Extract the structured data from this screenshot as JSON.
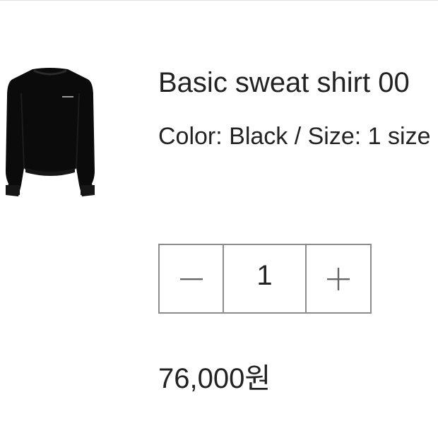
{
  "product": {
    "title": "Basic sweat shirt 00",
    "options": "Color: Black / Size: 1 size",
    "image_icon": "black-sweatshirt-thumbnail"
  },
  "quantity": {
    "value": "1",
    "decrement_icon": "minus-icon",
    "increment_icon": "plus-icon"
  },
  "price": {
    "text": "76,000원"
  },
  "colors": {
    "text": "#222222",
    "border": "#8c8c8c",
    "garment": "#0b0b0b"
  }
}
